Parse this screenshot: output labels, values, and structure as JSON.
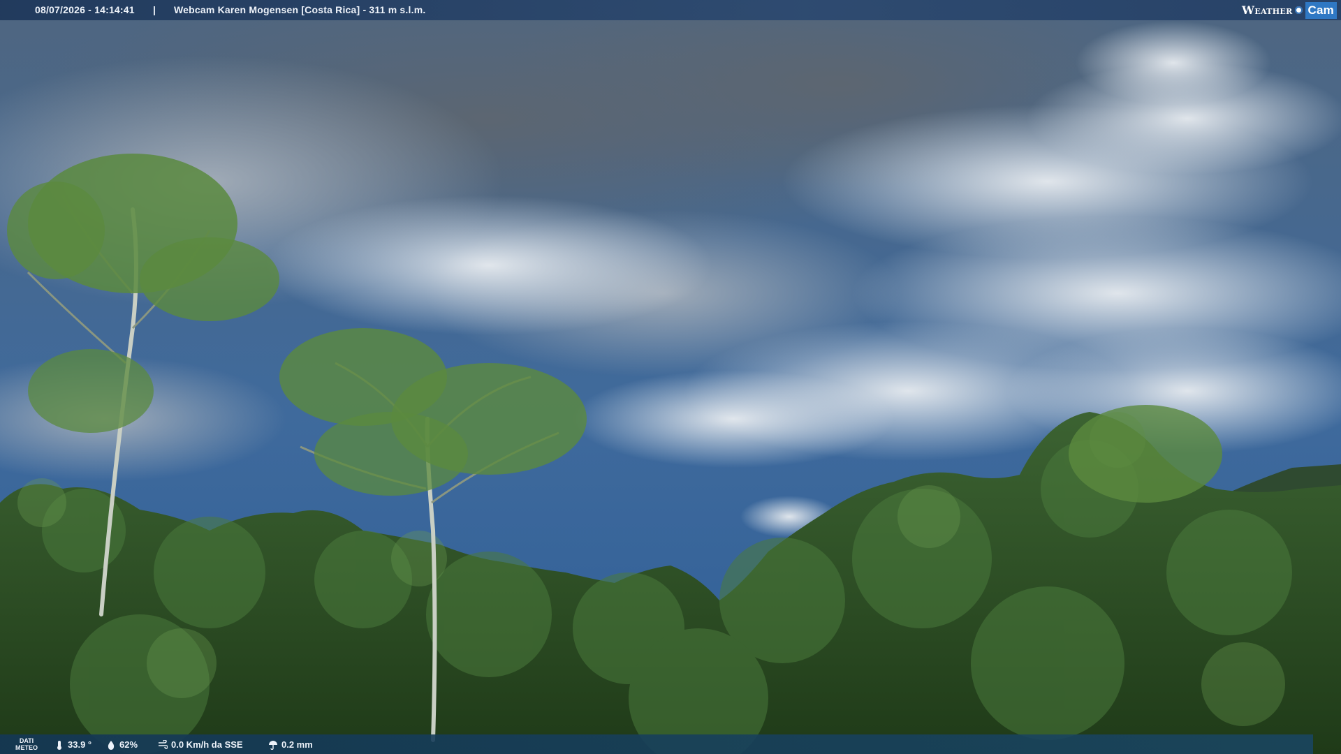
{
  "header": {
    "timestamp": "08/07/2026 - 14:14:41",
    "separator": "|",
    "caption": "Webcam Karen Mogensen [Costa Rica] - 311 m s.l.m.",
    "logo_part1": "Weather",
    "logo_part2": "Cam"
  },
  "footer": {
    "label_line1": "DATI",
    "label_line2": "METEO",
    "temperature": "33.9 °",
    "humidity": "62%",
    "wind": "0.0 Km/h da SSE",
    "rain": "0.2 mm"
  },
  "icons": {
    "temperature": "thermometer-icon",
    "humidity": "humidity-icon",
    "wind": "wind-icon",
    "rain": "umbrella-icon",
    "logo": "weathercam-logo"
  },
  "colors": {
    "sky": "#3d6a9e",
    "cloud": "#dfe4ea",
    "forest": "#2f4f24",
    "bar": "#1e375a",
    "logo_accent": "#2f78c4"
  }
}
